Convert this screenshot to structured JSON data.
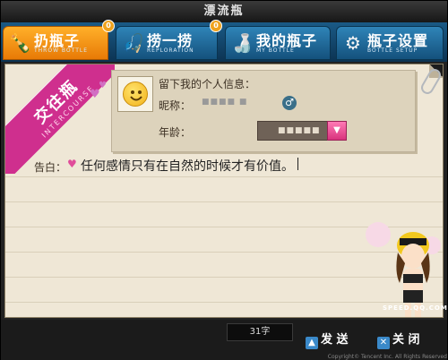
{
  "window": {
    "title": "漂流瓶"
  },
  "tabs": [
    {
      "label": "扔瓶子",
      "sub": "THROW BOTTLE",
      "badge": "0",
      "icon": "bottle-throw-icon",
      "active": true
    },
    {
      "label": "捞一捞",
      "sub": "REPLORATION",
      "badge": "0",
      "icon": "fishing-net-icon",
      "active": false
    },
    {
      "label": "我的瓶子",
      "sub": "MY BOTTLE",
      "badge": "",
      "icon": "my-bottle-icon",
      "active": false
    },
    {
      "label": "瓶子设置",
      "sub": "BOTTLE SETUP",
      "badge": "",
      "icon": "gear-icon",
      "active": false
    }
  ],
  "ribbon": {
    "title": "交往瓶",
    "subtitle": "INTERCOURSE"
  },
  "info": {
    "title": "留下我的个人信息：",
    "nickname_label": "昵称：",
    "nickname_value": "■■■■ ■",
    "gender_icon": "male-icon",
    "age_label": "年龄：",
    "age_value": "■■■■■"
  },
  "message": {
    "label": "告白：",
    "text": "任何感情只有在自然的时候才有价值。"
  },
  "bottom": {
    "char_count": "31字",
    "send_label": "发 送",
    "close_label": "关 闭",
    "logo_text": "SPEED.QQ.COM",
    "copyright": "Copyright© Tencent Inc. All Rights Reserved"
  }
}
